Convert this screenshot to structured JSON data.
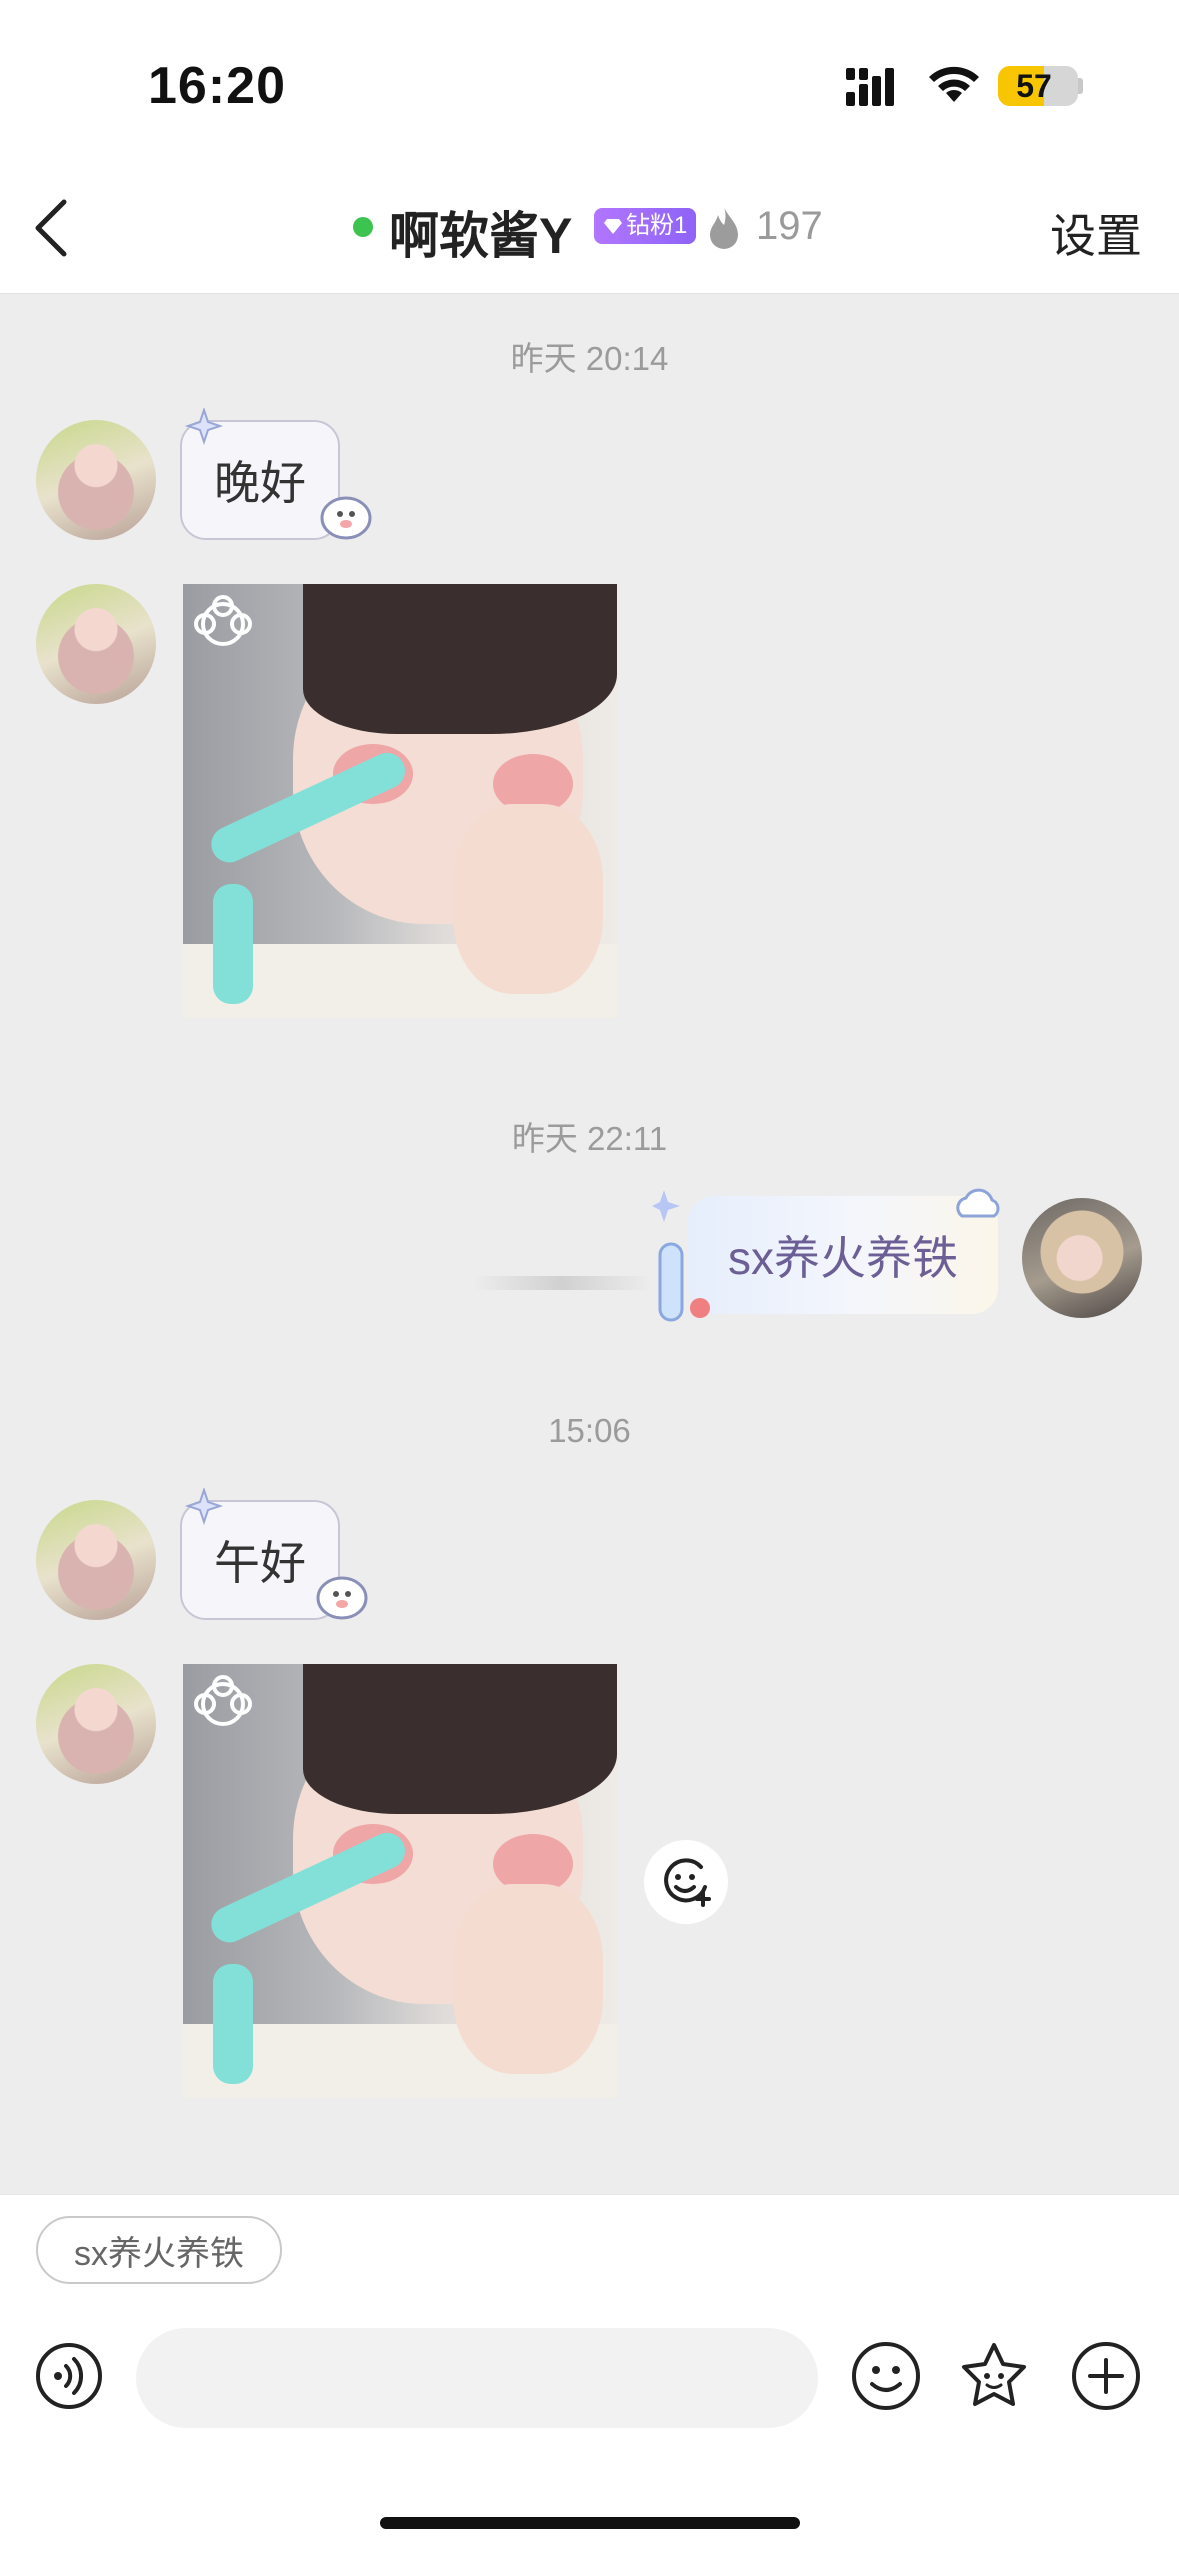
{
  "status_bar": {
    "time": "16:20",
    "battery": "57",
    "battery_fill_fraction": 0.57,
    "battery_color": "#f7c600"
  },
  "nav": {
    "back_icon": "chevron-left-icon",
    "online_color": "#3dc450",
    "nickname": "啊软酱Y",
    "fan_badge": "钻粉1",
    "heat_value": "197",
    "settings_label": "设置"
  },
  "messages": [
    {
      "type": "timestamp",
      "text": "昨天 20:14"
    },
    {
      "type": "text",
      "from": "them",
      "text": "晚好"
    },
    {
      "type": "image",
      "from": "them",
      "alt_icon": "photo-icon"
    },
    {
      "type": "timestamp",
      "text": "昨天 22:11"
    },
    {
      "type": "text",
      "from": "me",
      "text": "sx养火养铁"
    },
    {
      "type": "timestamp",
      "text": "15:06"
    },
    {
      "type": "text",
      "from": "them",
      "text": "午好"
    },
    {
      "type": "image",
      "from": "them",
      "alt_icon": "photo-icon"
    }
  ],
  "quick_reply": {
    "chip": "sx养火养铁"
  },
  "input_bar": {
    "voice_icon": "voice-icon",
    "emoji_icon": "emoji-icon",
    "sticker_icon": "sticker-icon",
    "plus_icon": "plus-icon"
  }
}
